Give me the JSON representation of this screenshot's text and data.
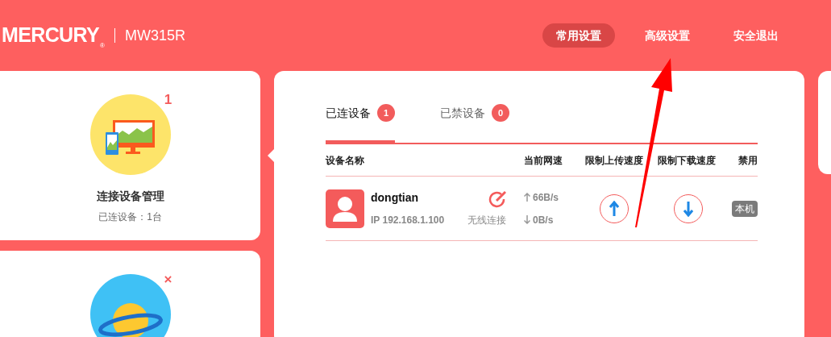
{
  "header": {
    "brand": "MERCURY",
    "registered": "®",
    "model": "MW315R",
    "nav": [
      {
        "label": "常用设置",
        "selected": true
      },
      {
        "label": "高级设置",
        "selected": false
      },
      {
        "label": "安全退出",
        "selected": false
      }
    ]
  },
  "sidebar": {
    "items": [
      {
        "kind": "devices",
        "badge": "1",
        "title": "连接设备管理",
        "subtitle": "已连设备：1台",
        "selected": true
      },
      {
        "kind": "internet",
        "badge": "×",
        "selected": false
      }
    ]
  },
  "tabs": [
    {
      "label": "已连设备",
      "count": "1",
      "selected": true
    },
    {
      "label": "已禁设备",
      "count": "0",
      "selected": false
    }
  ],
  "table": {
    "columns": [
      "设备名称",
      "当前网速",
      "限制上传速度",
      "限制下载速度",
      "禁用"
    ],
    "rows": [
      {
        "name": "dongtian",
        "ip": "IP 192.168.1.100",
        "connection": "无线连接",
        "upload": "66B/s",
        "download": "0B/s",
        "tag": "本机"
      }
    ]
  }
}
